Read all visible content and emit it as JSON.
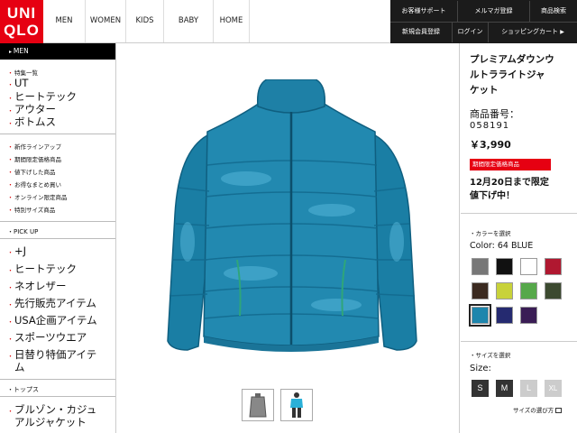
{
  "header": {
    "logo": [
      "UNI",
      "QLO"
    ],
    "nav": [
      "MEN",
      "WOMEN",
      "KIDS",
      "BABY",
      "HOME"
    ],
    "util_top": [
      "お客様サポート",
      "メルマガ登録",
      "商品検索"
    ],
    "util_bottom": [
      "新規会員登録",
      "ログイン",
      "ショッピングカート"
    ]
  },
  "sidebar": {
    "header": "MEN",
    "group1_small": "特集一覧",
    "group1": [
      "UT",
      "ヒートテック",
      "アウター",
      "ボトムス"
    ],
    "group2": [
      "新作ラインアップ",
      "期間限定価格商品",
      "値下げした商品",
      "お得なまとめ買い",
      "オンライン限定商品",
      "特別サイズ商品"
    ],
    "section_pickup": "PICK UP",
    "group3": [
      "+J",
      "ヒートテック",
      "ネオレザー",
      "先行販売アイテム",
      "USA企画アイテム",
      "スポーツウエア",
      "日替り特価アイテ",
      "ム"
    ],
    "section_tops": "トップス",
    "group4": [
      "ブルゾン・カジュ",
      "アルジャケット"
    ]
  },
  "product": {
    "title": [
      "プレミアムダウンウ",
      "ルトラライトジャ",
      "ケット"
    ],
    "code_label": "商品番号：",
    "code": "058191",
    "price": "￥3,990",
    "badge": "期間限定価格商品",
    "promo": [
      "12月20日まで限定",
      "値下げ中！"
    ],
    "color_section": "カラーを選択",
    "color_label": "Color: 64 BLUE",
    "size_section": "サイズを選択",
    "size_label": "Size:",
    "sizes": [
      "S",
      "M",
      "L",
      "XL"
    ],
    "size_guide": "サイズの選び方"
  },
  "colors": {
    "brand_red": "#e60012",
    "jacket": "#1e86ad",
    "swatches": [
      "#777777",
      "#111111",
      "#ffffff",
      "#b01830",
      "#3b2a20",
      "#c8d23a",
      "#56a84a",
      "#3c4a30",
      "#1e86ad",
      "#252a70",
      "#3a1d55"
    ],
    "selected_swatch": "#1e86ad"
  }
}
